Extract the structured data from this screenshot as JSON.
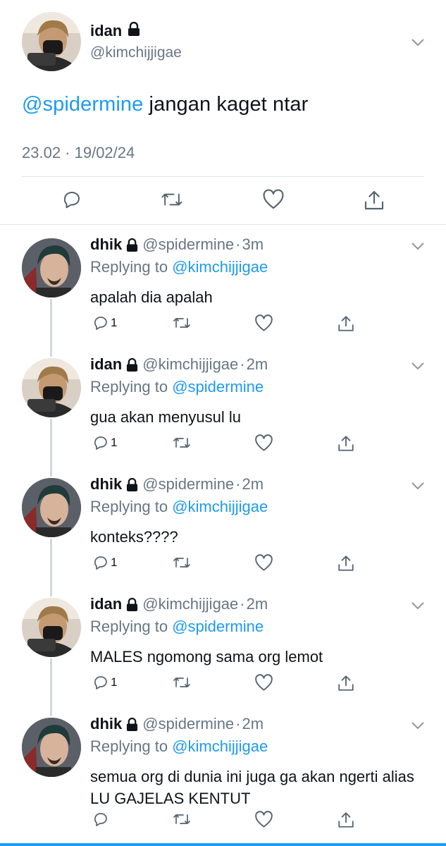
{
  "main": {
    "name": "idan",
    "handle": "@kimchijjigae",
    "mention": "@spidermine",
    "text": " jangan kaget ntar",
    "timestamp": "23.02 · 19/02/24"
  },
  "replies": [
    {
      "name": "dhik",
      "handle": "@spidermine",
      "time": "3m",
      "replying_label": "Replying to",
      "replying_to": "@kimchijjigae",
      "text": "apalah dia apalah",
      "reply_count": "1",
      "avatar": "dhik"
    },
    {
      "name": "idan",
      "handle": "@kimchijjigae",
      "time": "2m",
      "replying_label": "Replying to",
      "replying_to": "@spidermine",
      "text": "gua akan menyusul lu",
      "reply_count": "1",
      "avatar": "idan"
    },
    {
      "name": "dhik",
      "handle": "@spidermine",
      "time": "2m",
      "replying_label": "Replying to",
      "replying_to": "@kimchijjigae",
      "text": "konteks????",
      "reply_count": "1",
      "avatar": "dhik"
    },
    {
      "name": "idan",
      "handle": "@kimchijjigae",
      "time": "2m",
      "replying_label": "Replying to",
      "replying_to": "@spidermine",
      "text": "MALES ngomong sama org lemot",
      "reply_count": "1",
      "avatar": "idan"
    },
    {
      "name": "dhik",
      "handle": "@spidermine",
      "time": "2m",
      "replying_label": "Replying to",
      "replying_to": "@kimchijjigae",
      "text": "semua org di dunia ini juga ga akan ngerti alias LU GAJELAS KENTUT",
      "reply_count": "",
      "avatar": "dhik"
    }
  ],
  "icons": {
    "reply": "reply-icon",
    "retweet": "retweet-icon",
    "like": "like-icon",
    "share": "share-icon",
    "lock": "lock-icon",
    "more": "chevron-down-icon"
  },
  "colors": {
    "link": "#1d9bf0",
    "secondary_text": "#687684",
    "divider": "#dfe3e6"
  }
}
